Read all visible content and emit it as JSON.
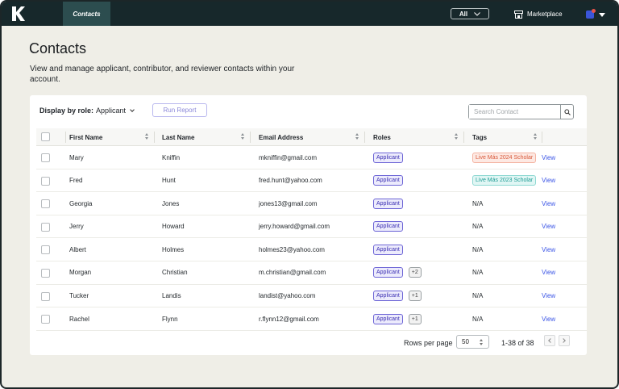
{
  "nav": {
    "active_tab": "Contacts",
    "filter_value": "All",
    "marketplace_label": "Marketplace"
  },
  "page": {
    "title": "Contacts",
    "description": "View and manage applicant, contributor, and reviewer contacts within your account."
  },
  "filters": {
    "display_label": "Display by role:",
    "role_value": "Applicant",
    "run_report_label": "Run Report",
    "search_placeholder": "Search Contact"
  },
  "table": {
    "columns": [
      "First Name",
      "Last Name",
      "Email Address",
      "Roles",
      "Tags"
    ],
    "rows": [
      {
        "first": "Mary",
        "last": "Kniffin",
        "email": "mkniffin@gmail.com",
        "role": "Applicant",
        "more": "",
        "tag": "Live Más 2024 Scholar",
        "tag_style": "orange",
        "action": "View"
      },
      {
        "first": "Fred",
        "last": "Hunt",
        "email": "fred.hunt@yahoo.com",
        "role": "Applicant",
        "more": "",
        "tag": "Live Más 2023 Scholar",
        "tag_style": "teal",
        "action": "View"
      },
      {
        "first": "Georgia",
        "last": "Jones",
        "email": "jones13@gmail.com",
        "role": "Applicant",
        "more": "",
        "tag": "N/A",
        "tag_style": "none",
        "action": "View"
      },
      {
        "first": "Jerry",
        "last": "Howard",
        "email": "jerry.howard@gmail.com",
        "role": "Applicant",
        "more": "",
        "tag": "N/A",
        "tag_style": "none",
        "action": "View"
      },
      {
        "first": "Albert",
        "last": "Holmes",
        "email": "holmes23@yahoo.com",
        "role": "Applicant",
        "more": "",
        "tag": "N/A",
        "tag_style": "none",
        "action": "View"
      },
      {
        "first": "Morgan",
        "last": "Christian",
        "email": "m.christian@gmail.com",
        "role": "Applicant",
        "more": "+2",
        "tag": "N/A",
        "tag_style": "none",
        "action": "View"
      },
      {
        "first": "Tucker",
        "last": "Landis",
        "email": "landist@yahoo.com",
        "role": "Applicant",
        "more": "+1",
        "tag": "N/A",
        "tag_style": "none",
        "action": "View"
      },
      {
        "first": "Rachel",
        "last": "Flynn",
        "email": "r.flynn12@gmail.com",
        "role": "Applicant",
        "more": "+1",
        "tag": "N/A",
        "tag_style": "none",
        "action": "View"
      }
    ]
  },
  "pagination": {
    "rows_per_page_label": "Rows per page",
    "rows_per_page_value": "50",
    "range_label": "1-38 of 38"
  },
  "colors": {
    "nav_bg": "#17282b",
    "active_tab_bg": "#2c4d4f",
    "page_bg": "#efeee7",
    "link": "#3c56e6",
    "role_badge": "#6d65d6"
  }
}
